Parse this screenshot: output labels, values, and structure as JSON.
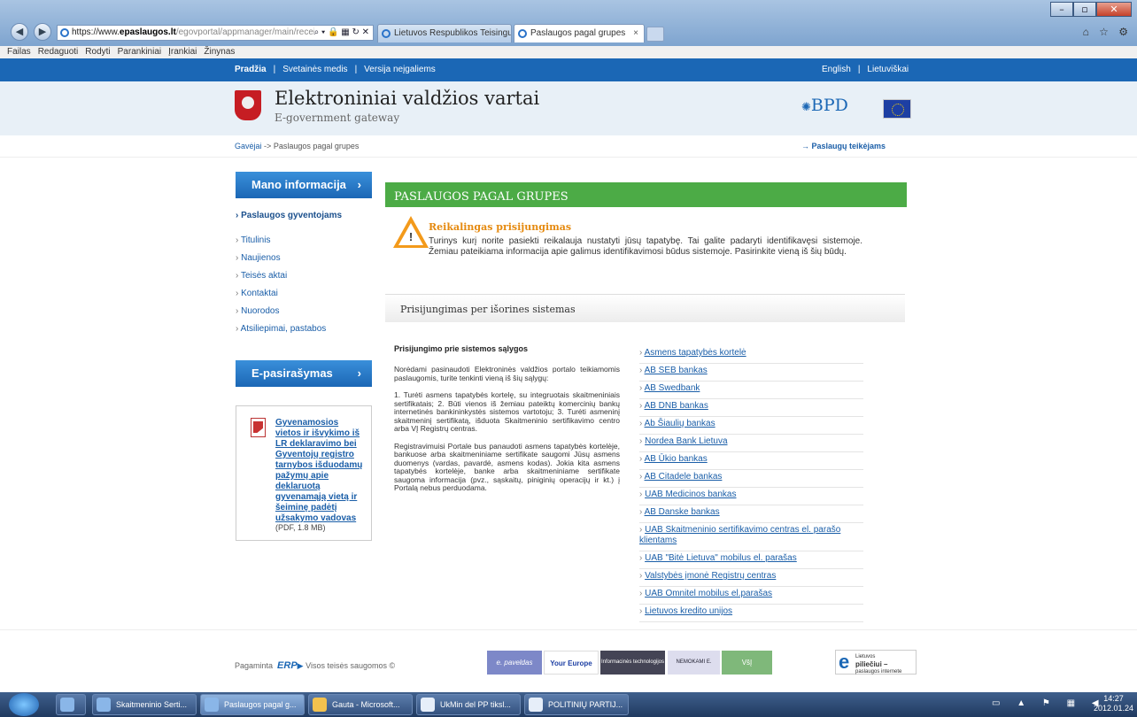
{
  "browser": {
    "url_prefix": "https://www.",
    "url_host": "epaslaugos.lt",
    "url_path": "/egovportal/appmanager/main/recei",
    "url_tools": "⌕ ▾ 🔒 ▦ ↻ ✕",
    "tabs": [
      {
        "label": "Lietuvos Respublikos Teisingu..."
      },
      {
        "label": "Paslaugos pagal grupes"
      }
    ],
    "tab_close": "×",
    "right_icons": "⌂ ☆ ⚙",
    "window_controls": {
      "minimize": "–",
      "maximize": "▫",
      "close": "✕"
    },
    "menu": [
      "Failas",
      "Redaguoti",
      "Rodyti",
      "Parankiniai",
      "Įrankiai",
      "Žinynas"
    ]
  },
  "topbar": {
    "home": "Pradžia",
    "sitemap": "Svetainės medis",
    "accessible": "Versija neįgaliems",
    "sep": "|",
    "english": "English",
    "lithuanian": "Lietuviškai"
  },
  "header": {
    "title": "Elektroniniai valdžios vartai",
    "subtitle": "E-government gateway",
    "bpd": "BPD",
    "bpd_star": "✺"
  },
  "breadcrumb": {
    "root": "Gavėjai",
    "arrow": "->",
    "current": "Paslaugos pagal grupes",
    "providers": "→ Paslaugų teikėjams"
  },
  "sidebar": {
    "mano_btn": "Mano informacija",
    "btn_arrow": "›",
    "active_item": "› Paslaugos gyventojams",
    "items": [
      "Titulinis",
      "Naujienos",
      "Teisės aktai",
      "Kontaktai",
      "Nuorodos",
      "Atsiliepimai, pastabos"
    ],
    "epas_btn": "E-pasirašymas",
    "doc_link": "Gyvenamosios vietos ir išvykimo iš LR deklaravimo bei Gyventojų registro tarnybos išduodamų pažymų apie deklaruotą gyvenamąją vietą ir šeiminę padėtį užsakymo vadovas",
    "doc_meta": "(PDF, 1.8 MB)"
  },
  "main": {
    "section_title": "PASLAUGOS PAGAL GRUPES",
    "warning_symbol": "!",
    "warning_title": "Reikalingas prisijungimas",
    "warning_text": "Turinys kurį norite pasiekti reikalauja nustatyti jūsų tapatybę. Tai galite padaryti identifikavęsi sistemoje. Žemiau pateikiama informacija apie galimus identifikavimosi būdus sistemoje. Pasirinkite vieną iš šių būdų.",
    "external_title": "Prisijungimas per išorines sistemas",
    "conditions_title": "Prisijungimo prie sistemos sąlygos",
    "conditions_p1": "Norėdami pasinaudoti Elektroninės valdžios portalo teikiamomis paslaugomis, turite tenkinti vieną iš šių sąlygų:",
    "conditions_p2": "1. Turėti asmens tapatybės kortelę, su integruotais skaitmeniniais sertifikatais; 2. Būti vienos iš žemiau pateiktų komercinių bankų internetinės bankininkystės sistemos vartotoju; 3. Turėti asmeninį skaitmeninį sertifikatą, išduota Skaitmeninio sertifikavimo centro arba VĮ Registrų centras.",
    "conditions_p3": "Registravimuisi Portale bus panaudoti asmens tapatybės kortelėje, bankuose arba skaitmeniniame sertifikate saugomi Jūsų asmens duomenys (vardas, pavardė, asmens kodas). Jokia kita asmens tapatybės kortelėje, banke arba skaitmeniniame sertifikate saugoma informacija (pvz., sąskaitų, piniginių operacijų ir kt.) į Portalą nebus perduodama.",
    "banks": [
      "Asmens tapatybės kortelė",
      "AB SEB bankas",
      "AB Swedbank",
      "AB DNB bankas",
      "Ab Šiaulių bankas",
      "Nordea Bank Lietuva",
      "AB Ūkio bankas",
      "AB Citadele bankas",
      "UAB Medicinos bankas",
      "AB Danske bankas",
      "UAB Skaitmeninio sertifikavimo centras el. parašo klientams",
      "UAB \"Bitė Lietuva\" mobilus el. parašas",
      "Valstybės įmonė Registrų centras",
      "UAB Omnitel mobilus el.parašas",
      "Lietuvos kredito unijos"
    ]
  },
  "footer": {
    "made_by": "Pagaminta",
    "erp": "ERP",
    "rights": "Visos teisės saugomos ©",
    "banners": [
      "e. paveldas",
      "Your Europe",
      "Informacinės technologijos",
      "NEMOKAMI E. KURSAI",
      "VšĮ"
    ],
    "epil_logo": "e",
    "epil_top": "Lietuvos",
    "epil_name": "piliečiui –",
    "epil_sub": "paslaugos internete"
  },
  "taskbar": {
    "items": [
      "Skaitmeninio Serti...",
      "Paslaugos pagal g...",
      "Gauta - Microsoft...",
      "UkMin del PP tiksl...",
      "POLITINIŲ PARTIJ..."
    ],
    "tray_icons": "▭ ▲ ⚑ ▦ ◀",
    "time": "14:27",
    "date": "2012.01.24"
  },
  "colors": {
    "brand_blue": "#1b67b5",
    "green": "#4cab46",
    "warning": "#f39a1b"
  }
}
